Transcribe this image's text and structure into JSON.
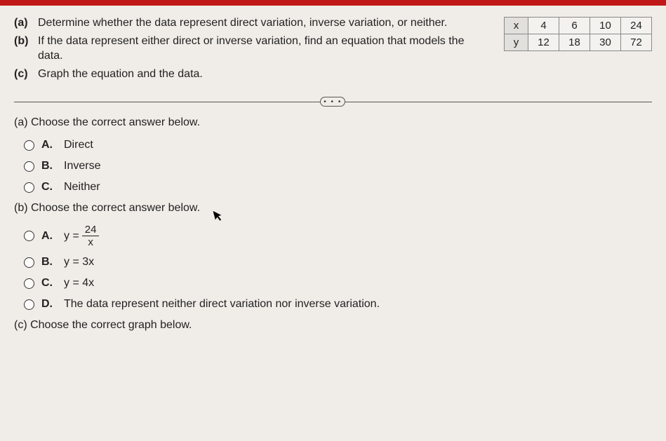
{
  "questions": {
    "a": {
      "label": "(a)",
      "text": "Determine whether the data represent direct variation, inverse variation, or neither."
    },
    "b": {
      "label": "(b)",
      "text": "If the data represent either direct or inverse variation, find an equation that models the data."
    },
    "c": {
      "label": "(c)",
      "text": "Graph the equation and the data."
    }
  },
  "table": {
    "rows": [
      {
        "hdr": "x",
        "c1": "4",
        "c2": "6",
        "c3": "10",
        "c4": "24"
      },
      {
        "hdr": "y",
        "c1": "12",
        "c2": "18",
        "c3": "30",
        "c4": "72"
      }
    ]
  },
  "divider": {
    "dots": "• • •"
  },
  "partA": {
    "prompt": "(a) Choose the correct answer below.",
    "opts": {
      "A": {
        "letter": "A.",
        "text": "Direct"
      },
      "B": {
        "letter": "B.",
        "text": "Inverse"
      },
      "C": {
        "letter": "C.",
        "text": "Neither"
      }
    }
  },
  "partB": {
    "prompt": "(b) Choose the correct answer below.",
    "opts": {
      "A": {
        "letter": "A.",
        "lhs": "y =",
        "num": "24",
        "den": "x"
      },
      "B": {
        "letter": "B.",
        "text": "y = 3x"
      },
      "C": {
        "letter": "C.",
        "text": "y = 4x"
      },
      "D": {
        "letter": "D.",
        "text": "The data represent neither direct variation nor inverse variation."
      }
    }
  },
  "partC": {
    "prompt": "(c) Choose the correct graph below."
  },
  "chart_data": {
    "type": "table",
    "title": "x vs y data pairs",
    "categories": [
      "x",
      "y"
    ],
    "series": [
      {
        "name": "x",
        "values": [
          4,
          6,
          10,
          24
        ]
      },
      {
        "name": "y",
        "values": [
          12,
          18,
          30,
          72
        ]
      }
    ]
  }
}
